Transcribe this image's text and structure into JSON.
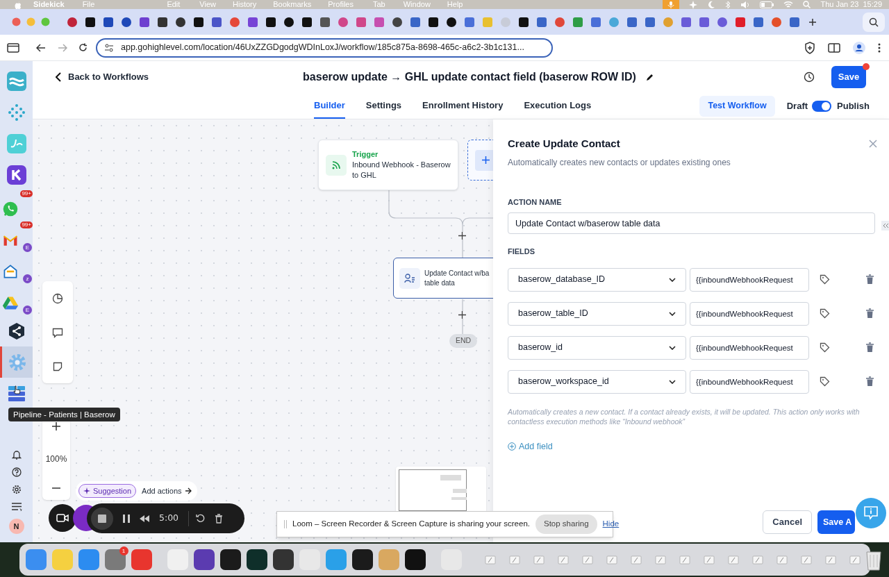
{
  "menubar": {
    "app": "Sidekick",
    "menus": [
      "File",
      "Edit",
      "View",
      "History",
      "Bookmarks",
      "Profiles",
      "Tab",
      "Window",
      "Help"
    ],
    "date": "Thu Jan 23",
    "time": "15:29"
  },
  "address_bar": {
    "url": "app.gohighlevel.com/location/46UxZZGDgodgWDInLoxJ/workflow/185c875a-8698-465c-a6c2-3b1c131..."
  },
  "sidebar": {
    "apps": [
      {
        "kind": "logo",
        "selected": false
      },
      {
        "kind": "dots",
        "selected": false
      },
      {
        "kind": "jane",
        "selected": false
      },
      {
        "kind": "k",
        "selected": false
      },
      {
        "kind": "chat",
        "badge": "99+",
        "selected": false
      },
      {
        "kind": "mail",
        "badge": "99+",
        "sub": "E",
        "selected": false
      },
      {
        "kind": "inbox",
        "sub": "z",
        "selected": false
      },
      {
        "kind": "drive",
        "sub": "E",
        "selected": false
      },
      {
        "kind": "share",
        "selected": false
      },
      {
        "kind": "gear",
        "selected": true
      },
      {
        "kind": "table",
        "selected": false
      }
    ],
    "tooltip": "Pipeline - Patients | Baserow",
    "avatar": "N"
  },
  "header": {
    "back": "Back to Workflows",
    "title": "baserow update → GHL update contact field (baserow ROW ID)",
    "save": "Save",
    "unsaved": true
  },
  "tabs": [
    {
      "label": "Builder",
      "selected": true
    },
    {
      "label": "Settings",
      "selected": false
    },
    {
      "label": "Enrollment History",
      "selected": false
    },
    {
      "label": "Execution Logs",
      "selected": false
    }
  ],
  "test_button": "Test Workflow",
  "publish_toggle": {
    "off_label": "Draft",
    "on_label": "Publish",
    "on": true
  },
  "canvas": {
    "trigger": {
      "label": "Trigger",
      "text": "Inbound Webhook - Baserow to GHL"
    },
    "action": {
      "lines": [
        "Update Contact w/ba",
        "table data"
      ]
    },
    "end": "END",
    "zoom": "100%",
    "suggestion": "Suggestion",
    "add_actions": "Add actions"
  },
  "panel": {
    "title": "Create Update Contact",
    "subtitle": "Automatically creates new contacts or updates existing ones",
    "action_name_label": "ACTION NAME",
    "action_name": "Update Contact w/baserow table data",
    "fields_label": "FIELDS",
    "fields": [
      {
        "name": "baserow_database_ID",
        "value": "{{inboundWebhookRequest"
      },
      {
        "name": "baserow_table_ID",
        "value": "{{inboundWebhookRequest"
      },
      {
        "name": "baserow_id",
        "value": "{{inboundWebhookRequest"
      },
      {
        "name": "baserow_workspace_id",
        "value": "{{inboundWebhookRequest"
      }
    ],
    "note": "Automatically creates a new contact. If a contact already exists, it will be updated. This action only works with contactless execution methods like “Inbound webhook”",
    "add_field": "Add field",
    "cancel": "Cancel",
    "save": "Save A"
  },
  "recorder": {
    "time": "5:00"
  },
  "share_bar": {
    "message": "Loom – Screen Recorder & Screen Capture is sharing your screen.",
    "stop": "Stop sharing",
    "hide": "Hide"
  },
  "dock": {
    "badge": "1"
  }
}
